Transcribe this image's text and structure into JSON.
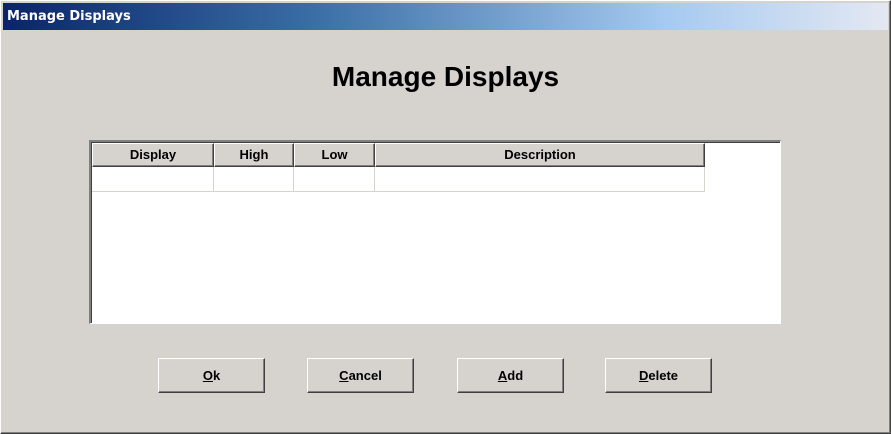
{
  "window": {
    "title": "Manage Displays"
  },
  "heading": "Manage Displays",
  "grid": {
    "columns": [
      {
        "label": "Display"
      },
      {
        "label": "High"
      },
      {
        "label": "Low"
      },
      {
        "label": "Description"
      }
    ],
    "rows": [
      [
        "",
        "",
        "",
        ""
      ]
    ]
  },
  "buttons": {
    "ok": {
      "accel": "O",
      "rest": "k"
    },
    "cancel": {
      "accel": "C",
      "rest": "ancel"
    },
    "add": {
      "accel": "A",
      "rest": "dd"
    },
    "delete": {
      "accel": "D",
      "rest": "elete"
    }
  },
  "colors": {
    "face": "#d6d3ce",
    "titlebar_start": "#0a246a",
    "titlebar_end": "#e4e8f2"
  }
}
